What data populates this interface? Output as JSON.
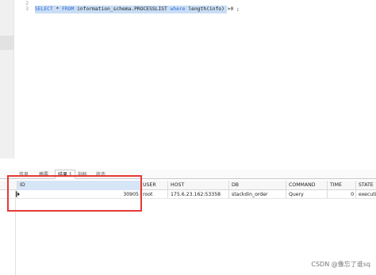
{
  "editor": {
    "line_numbers": [
      "2",
      "3"
    ],
    "sql": {
      "select": "SELECT",
      "star": " * ",
      "from": "FROM",
      "table": " information_schema.PROCESSLIST ",
      "where": "where",
      "condition": " length(info) >0 ;"
    }
  },
  "result_tabs": [
    "信息",
    "摘要",
    "结果 1",
    "剖析",
    "状态"
  ],
  "grid": {
    "columns": [
      "ID",
      "USER",
      "HOST",
      "DB",
      "COMMAND",
      "TIME",
      "STATE"
    ],
    "rows": [
      [
        "30905",
        "root",
        "175.6.23.162:53358",
        "stackdin_order",
        "Query",
        "0",
        "executin"
      ]
    ]
  },
  "watermark": "CSDN @像忘了谁sq",
  "colors": {
    "keyword": "#2f69d6",
    "selection": "#c9def5",
    "highlight_box": "#e53935"
  }
}
